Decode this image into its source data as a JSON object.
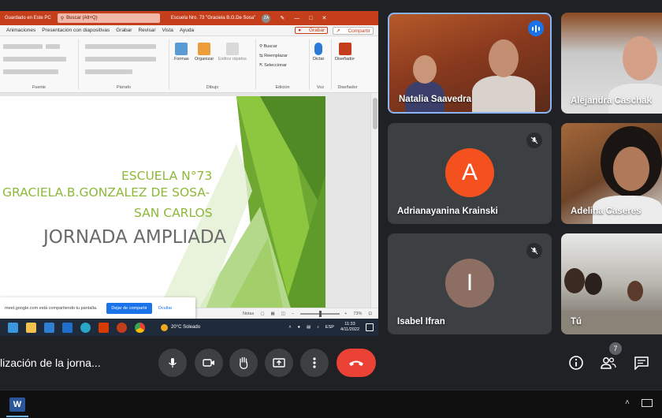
{
  "powerpoint": {
    "title_left": "Guardado en Este PC",
    "search_placeholder": "Buscar (Alt+Q)",
    "doc_title": "Escuela Nro. 73 \"Graciela B.G.De Sosa\"",
    "avatar_initials": "ZA",
    "tabs": [
      "Animaciones",
      "Presentación con diapositivas",
      "Grabar",
      "Revisar",
      "Vista",
      "Ayuda"
    ],
    "grabar_label": "Grabar",
    "compartir_label": "Compartir",
    "ribbon": {
      "groups": [
        "Fuente",
        "Párrafo",
        "Dibujo",
        "Edición",
        "Voz",
        "Diseñador"
      ],
      "formas": "Formas",
      "organizar": "Organizar",
      "estilos": "Estilos rápidos",
      "buscar": "Buscar",
      "reemplazar": "Reemplazar",
      "seleccionar": "Seleccionar",
      "dictar": "Dictar",
      "disenador": "Diseñador"
    },
    "slide": {
      "line1": "ESCUELA N°73",
      "line2": "GRACIELA.B.GONZALEZ DE SOSA-",
      "line3": "SAN CARLOS",
      "line4": "JORNADA AMPLIADA"
    },
    "status": {
      "notes": "Notas",
      "zoom": "73%"
    },
    "share_banner": {
      "message": "meet.google.com está compartiendo tu pantalla.",
      "stop_label": "Dejar de compartir",
      "hide_label": "Ocultar"
    },
    "taskbar": {
      "weather": "20°C  Soleado",
      "lang": "ESP",
      "time": "11:33",
      "date": "4/11/2022"
    }
  },
  "participants": [
    {
      "name": "Natalia Saavedra",
      "speaking": true
    },
    {
      "name": "Alejandra Caschak"
    },
    {
      "name": "Adrianayanina Krainski",
      "initial": "A",
      "avatar_color": "#f4511e",
      "muted": true
    },
    {
      "name": "Adelina Caseres"
    },
    {
      "name": "Isabel Ifran",
      "initial": "I",
      "avatar_color": "#8d6e63",
      "muted": true
    },
    {
      "name": "Tú"
    }
  ],
  "meet": {
    "meeting_title": "lización de la jorna...",
    "people_count": "7"
  },
  "colors": {
    "meet_bg": "#202124",
    "tile_bg": "#3c4043",
    "end_call": "#ea4335",
    "active_border": "#8ab4f8",
    "ppt_accent": "#c43e1c",
    "slide_green": "#8db93a"
  }
}
